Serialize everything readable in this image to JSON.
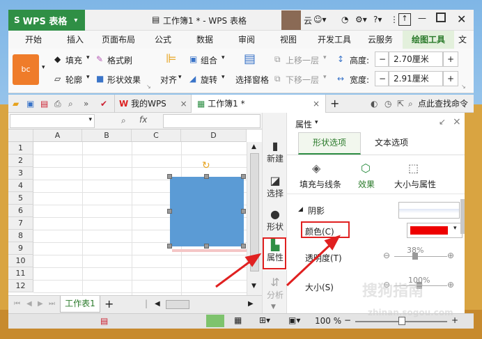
{
  "titlebar": {
    "app_label": "WPS 表格",
    "doc_title": "工作簿1 * - WPS 表格",
    "user_label": "云"
  },
  "ribbon_tabs": [
    "开始",
    "插入",
    "页面布局",
    "公式",
    "数据",
    "审阅",
    "视图",
    "开发工具",
    "云服务",
    "绘图工具",
    "文"
  ],
  "ribbon": {
    "shape_style_label": "bc",
    "fill_label": "填充",
    "format_painter_label": "格式刷",
    "outline_label": "轮廓",
    "shape_effect_label": "形状效果",
    "align_label": "对齐",
    "group_label": "组合",
    "rotate_label": "旋转",
    "select_pane_label": "选择窗格",
    "bring_forward_label": "上移一层",
    "send_backward_label": "下移一层",
    "height_label": "高度:",
    "height_value": "2.70厘米",
    "width_label": "宽度:",
    "width_value": "2.91厘米"
  },
  "doc_tabs": {
    "my_wps": "我的WPS",
    "workbook": "工作簿1 *",
    "search": "点此查找命令"
  },
  "sheet": {
    "fx_label": "fx",
    "columns": [
      "A",
      "B",
      "C",
      "D"
    ],
    "rows": [
      "1",
      "2",
      "3",
      "4",
      "5",
      "6",
      "7",
      "8",
      "9",
      "10",
      "11",
      "12"
    ],
    "sheet_tab": "工作表1"
  },
  "sidenav": {
    "new": "新建",
    "select": "选择",
    "shape": "形状",
    "properties": "属性",
    "analyze": "分析"
  },
  "panel": {
    "header": "属性",
    "tab_shape": "形状选项",
    "tab_text": "文本选项",
    "sub_fill": "填充与线条",
    "sub_effect": "效果",
    "sub_size": "大小与属性",
    "section_shadow": "阴影",
    "color_label": "颜色(C)",
    "transparency_label": "透明度(T)",
    "transparency_value": "38%",
    "size_label": "大小(S)",
    "size_value": "100%",
    "shadow_color": "#ee0000"
  },
  "statusbar": {
    "zoom": "100 %"
  },
  "watermark": {
    "cn": "搜狗指南",
    "url": "zhinan.sogou.com"
  }
}
